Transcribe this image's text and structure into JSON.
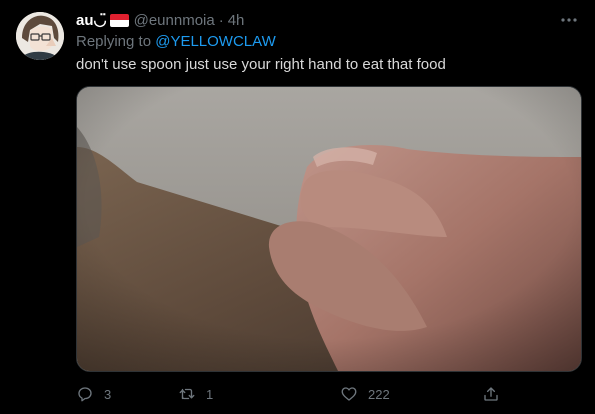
{
  "tweet": {
    "display_name": "au",
    "display_name_suffix": "◡̈",
    "flag_icon": "indonesia-flag-icon",
    "handle": "@eunnmoia",
    "separator": "·",
    "time": "4h",
    "replying_prefix": "Replying to ",
    "replying_to": "@YELLOWCLAW",
    "text": "don't use spoon just use your right hand to eat that food",
    "more_icon": "more-dots-icon"
  },
  "actions": {
    "reply_count": "3",
    "retweet_count": "1",
    "like_count": "222",
    "share_icon": "share-icon"
  },
  "colors": {
    "background": "#000000",
    "text": "#d9d9d9",
    "muted": "#6e767d",
    "accent": "#1d9bf0"
  }
}
